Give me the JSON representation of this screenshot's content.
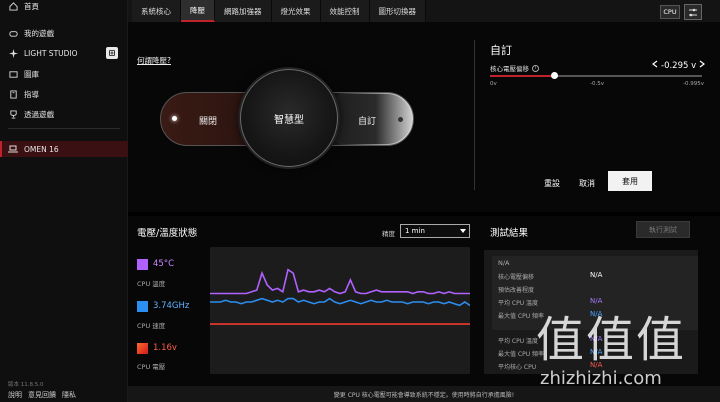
{
  "sidebar": {
    "items": [
      {
        "label": "首頁",
        "icon": "home-icon"
      },
      {
        "label": "我的遊戲",
        "icon": "gamepad-icon"
      },
      {
        "label": "LIGHT STUDIO",
        "icon": "sparkle-icon"
      },
      {
        "label": "圖庫",
        "icon": "gallery-icon"
      },
      {
        "label": "指導",
        "icon": "guide-icon"
      },
      {
        "label": "透過遊戲",
        "icon": "trophy-icon"
      }
    ],
    "device": {
      "label": "OMEN 16",
      "icon": "laptop-icon"
    },
    "version": "版本 11.8.5.0",
    "links": [
      "說明",
      "意見回饋",
      "隱私"
    ]
  },
  "tabs": [
    {
      "label": "系統核心",
      "active": false
    },
    {
      "label": "降壓",
      "active": true
    },
    {
      "label": "網路加強器",
      "active": false
    },
    {
      "label": "燈光效果",
      "active": false
    },
    {
      "label": "效能控制",
      "active": false
    },
    {
      "label": "圖形切換器",
      "active": false
    }
  ],
  "topbar": {
    "cpu_label": "CPU"
  },
  "undervolt": {
    "what_link": "何謂降壓?",
    "modes": {
      "off": "關閉",
      "smart": "智慧型",
      "custom": "自訂"
    },
    "custom_title": "自訂",
    "offset_label": "核心電壓偏移",
    "offset_value": "-0.295 v",
    "slider_fraction": 0.3,
    "ticks": [
      "0v",
      "-0.5v",
      "-0.995v"
    ],
    "buttons": {
      "reset": "重設",
      "cancel": "取消",
      "apply": "套用"
    }
  },
  "status": {
    "title": "電壓/溫度狀態",
    "granularity_label": "精度",
    "granularity_value": "1 min",
    "stats": [
      {
        "value": "45°C",
        "label": "CPU 溫度",
        "color": "#b061ff"
      },
      {
        "value": "3.74GHz",
        "label": "CPU 速度",
        "color": "#2b8ef0"
      },
      {
        "value": "1.16v",
        "label": "CPU 電壓",
        "color": "#ef3a2e"
      }
    ]
  },
  "chart_data": {
    "type": "line",
    "x": [
      0,
      1,
      2,
      3,
      4,
      5,
      6,
      7,
      8,
      9,
      10,
      11,
      12,
      13,
      14,
      15,
      16,
      17,
      18,
      19,
      20,
      21,
      22,
      23,
      24,
      25,
      26,
      27,
      28,
      29,
      30,
      31,
      32,
      33,
      34,
      35,
      36,
      37,
      38,
      39,
      40,
      41,
      42,
      43,
      44,
      45,
      46,
      47,
      48,
      49,
      50
    ],
    "series": [
      {
        "color": "#b061ff",
        "values": [
          45,
          45,
          45,
          45,
          45,
          45,
          45,
          45,
          46,
          47,
          57,
          50,
          47,
          48,
          46,
          59,
          57,
          46,
          47,
          46,
          46,
          47,
          46,
          48,
          46,
          45,
          46,
          53,
          46,
          45,
          45,
          46,
          47,
          46,
          46,
          46,
          46,
          46,
          46,
          45,
          46,
          46,
          45,
          45,
          46,
          45,
          46,
          45,
          45,
          45,
          45
        ]
      },
      {
        "color": "#2b8ef0",
        "values": [
          40,
          40,
          40,
          41,
          40,
          40,
          39,
          40,
          40,
          41,
          42,
          41,
          40,
          41,
          40,
          42,
          42,
          40,
          41,
          40,
          39,
          40,
          40,
          42,
          40,
          39,
          40,
          41,
          40,
          39,
          40,
          41,
          40,
          40,
          41,
          40,
          40,
          40,
          39,
          40,
          40,
          40,
          39,
          40,
          40,
          39,
          40,
          39,
          38,
          40,
          38
        ]
      },
      {
        "color": "#ef3a2e",
        "values": [
          27,
          27,
          27,
          27,
          27,
          27,
          27,
          27,
          27,
          27,
          27,
          27,
          27,
          27,
          27,
          27,
          27,
          27,
          27,
          27,
          27,
          27,
          27,
          27,
          27,
          27,
          27,
          27,
          27,
          27,
          27,
          27,
          27,
          27,
          27,
          27,
          27,
          27,
          27,
          27,
          27,
          27,
          27,
          27,
          27,
          27,
          27,
          27,
          27,
          27,
          27
        ]
      }
    ],
    "ylim": [
      0,
      70
    ]
  },
  "results": {
    "title": "測試結果",
    "run_button": "執行測試",
    "na_header": "N/A",
    "rows": [
      {
        "label": "核心電壓偏移",
        "value": "N/A",
        "style": "white"
      },
      {
        "label": "預估改善程度",
        "value": "",
        "style": "white"
      },
      {
        "label": "平均 CPU 溫度",
        "value": "N/A",
        "style": "purple"
      },
      {
        "label": "最大值 CPU 頻率",
        "value": "N/A",
        "style": "blue"
      }
    ],
    "rows2": [
      {
        "label": "平均 CPU 溫度",
        "value": "N/A",
        "style": "purple"
      },
      {
        "label": "最大值 CPU 頻率",
        "value": "N/A",
        "style": "blue"
      },
      {
        "label": "平均核心 CPU",
        "value": "N/A",
        "style": "red"
      }
    ]
  },
  "warning": "變更 CPU 核心電壓可能會導致系統不穩定。使用時將自行承擔風險!",
  "watermark": {
    "chars": "值值值",
    "url": "zhizhizhi.com"
  }
}
